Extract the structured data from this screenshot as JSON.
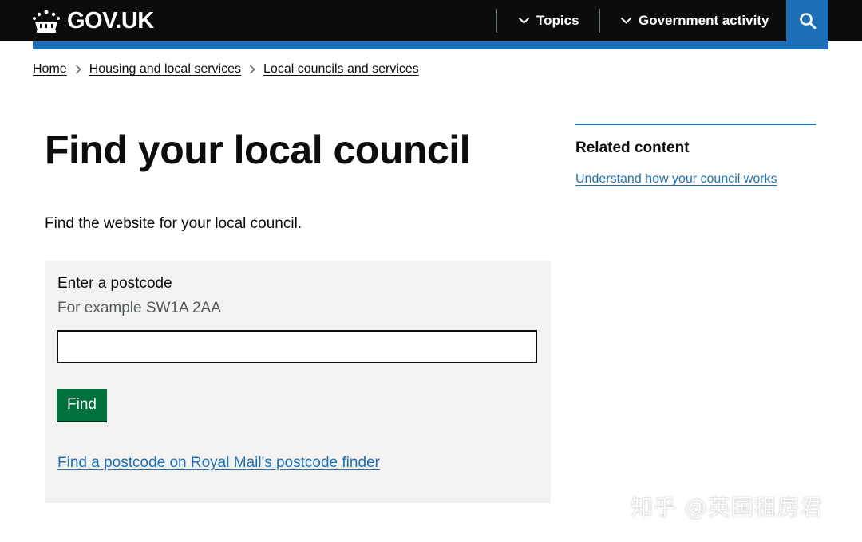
{
  "header": {
    "logo_text": "GOV.UK",
    "nav": [
      {
        "label": "Topics",
        "icon": "chevron-down-icon"
      },
      {
        "label": "Government activity",
        "icon": "chevron-down-icon"
      }
    ],
    "search_icon": "search-icon"
  },
  "breadcrumb": [
    "Home",
    "Housing and local services",
    "Local councils and services"
  ],
  "main": {
    "title": "Find your local council",
    "lede": "Find the website for your local council.",
    "form": {
      "label": "Enter a postcode",
      "hint": "For example SW1A 2AA",
      "input_value": "",
      "button_label": "Find",
      "finder_link": "Find a postcode on Royal Mail's postcode finder"
    }
  },
  "related": {
    "heading": "Related content",
    "links": [
      "Understand how your council works"
    ]
  },
  "watermark": "知乎 @英国租房君",
  "colors": {
    "header_bg": "#0b0c0c",
    "brand_blue": "#1d70b8",
    "button_green": "#00703c",
    "panel_bg": "#f3f2f1"
  }
}
